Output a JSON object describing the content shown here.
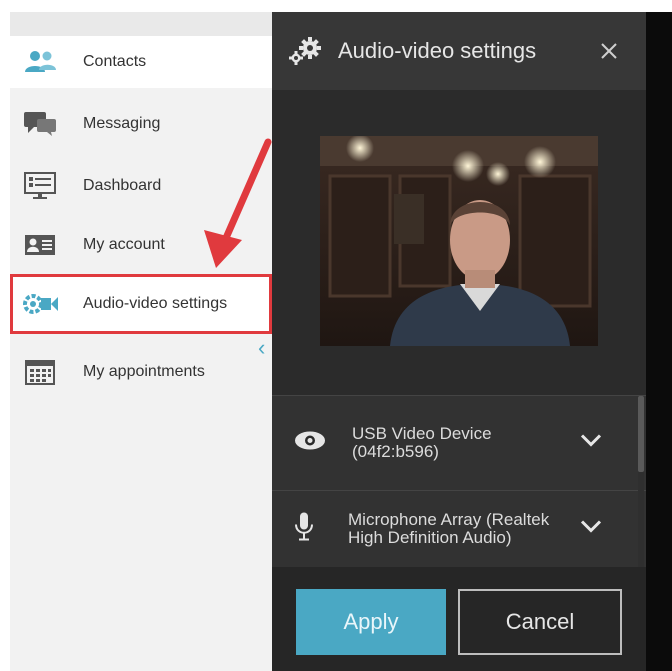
{
  "sidebar": {
    "items": [
      {
        "label": "Contacts",
        "icon": "contacts-icon"
      },
      {
        "label": "Messaging",
        "icon": "messaging-icon"
      },
      {
        "label": "Dashboard",
        "icon": "dashboard-icon"
      },
      {
        "label": "My account",
        "icon": "account-card-icon"
      },
      {
        "label": "Audio-video settings",
        "icon": "audio-video-settings-icon"
      },
      {
        "label": "My appointments",
        "icon": "calendar-icon"
      }
    ],
    "collapse_glyph": "‹"
  },
  "panel": {
    "title": "Audio-video settings",
    "close_glyph": "✕",
    "video_device": {
      "label": "USB Video Device (04f2:b596)",
      "icon": "webcam-icon"
    },
    "microphone": {
      "label": "Microphone Array (Realtek High Definition Audio)",
      "icon": "microphone-icon"
    },
    "apply_label": "Apply",
    "cancel_label": "Cancel"
  },
  "colors": {
    "accent": "#4aa8c4",
    "panel_bg": "#2b2b2b",
    "highlight": "#e03a3e"
  }
}
